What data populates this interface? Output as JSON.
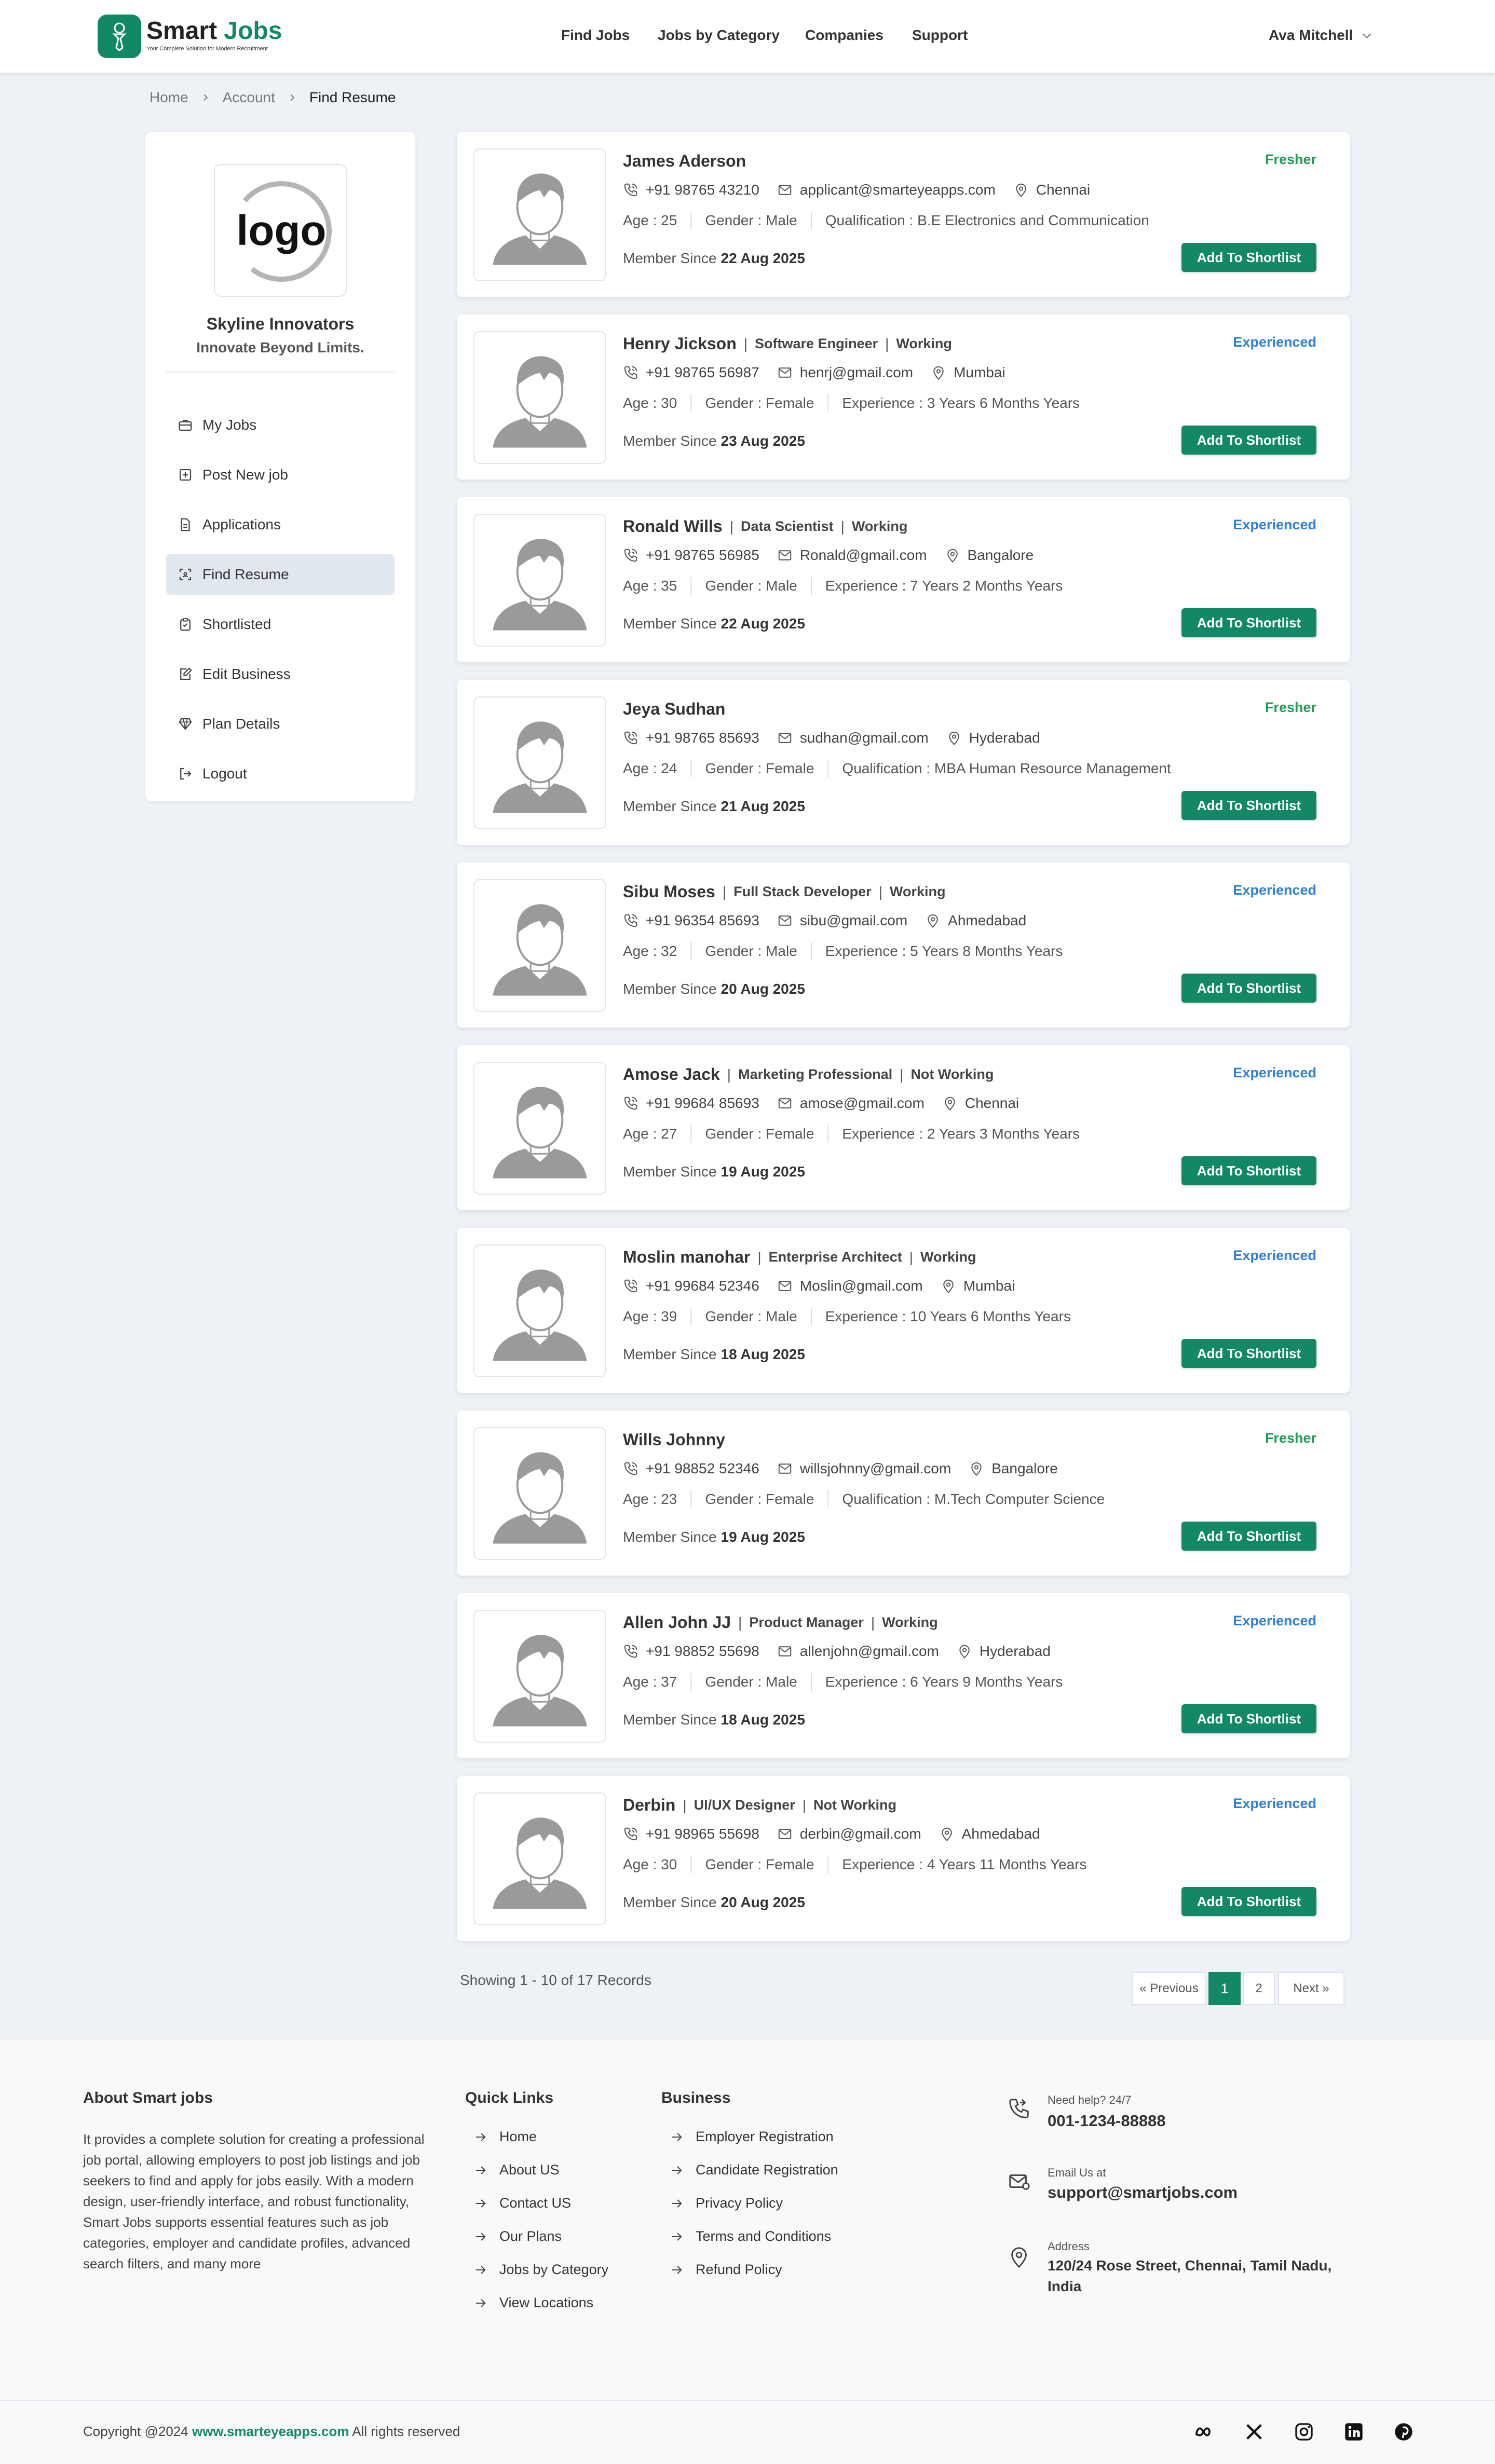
{
  "brand": {
    "name_a": "Smart",
    "name_b": "Jobs",
    "tagline": "Your Complete Solution for Modern Recruitment"
  },
  "nav": {
    "items": [
      "Find Jobs",
      "Jobs by Category",
      "Companies",
      "Support"
    ],
    "user": "Ava Mitchell"
  },
  "breadcrumb": [
    "Home",
    "Account",
    "Find Resume"
  ],
  "company": {
    "logo_text": "logo",
    "name": "Skyline Innovators",
    "tagline": "Innovate Beyond Limits."
  },
  "menu": [
    {
      "label": "My Jobs",
      "icon": "briefcase-icon"
    },
    {
      "label": "Post New job",
      "icon": "plus-square-icon"
    },
    {
      "label": "Applications",
      "icon": "document-icon"
    },
    {
      "label": "Find Resume",
      "icon": "scan-icon",
      "active": true
    },
    {
      "label": "Shortlisted",
      "icon": "clipboard-check-icon"
    },
    {
      "label": "Edit Business",
      "icon": "edit-icon"
    },
    {
      "label": "Plan Details",
      "icon": "diamond-icon"
    },
    {
      "label": "Logout",
      "icon": "logout-icon"
    }
  ],
  "labels": {
    "member_since": "Member Since",
    "shortlist_button": "Add To Shortlist"
  },
  "candidates": [
    {
      "name": "James Aderson",
      "role": "",
      "work_status": "",
      "type": "Fresher",
      "phone": "+91 98765 43210",
      "email": "applicant@smarteyeapps.com",
      "location": "Chennai",
      "age": "Age : 25",
      "gender": "Gender : Male",
      "detail": "Qualification : B.E Electronics and Communication",
      "date": "22 Aug 2025"
    },
    {
      "name": "Henry Jickson",
      "role": "Software Engineer",
      "work_status": "Working",
      "type": "Experienced",
      "phone": "+91 98765 56987",
      "email": "henrj@gmail.com",
      "location": "Mumbai",
      "age": "Age : 30",
      "gender": "Gender : Female",
      "detail": "Experience : 3 Years 6 Months Years",
      "date": "23 Aug 2025"
    },
    {
      "name": "Ronald Wills",
      "role": "Data Scientist",
      "work_status": "Working",
      "type": "Experienced",
      "phone": "+91 98765 56985",
      "email": "Ronald@gmail.com",
      "location": "Bangalore",
      "age": "Age : 35",
      "gender": "Gender : Male",
      "detail": "Experience : 7 Years 2 Months Years",
      "date": "22 Aug 2025"
    },
    {
      "name": "Jeya Sudhan",
      "role": "",
      "work_status": "",
      "type": "Fresher",
      "phone": "+91 98765 85693",
      "email": "sudhan@gmail.com",
      "location": "Hyderabad",
      "age": "Age : 24",
      "gender": "Gender : Female",
      "detail": "Qualification : MBA Human Resource Management",
      "date": "21 Aug 2025"
    },
    {
      "name": "Sibu Moses",
      "role": "Full Stack Developer",
      "work_status": "Working",
      "type": "Experienced",
      "phone": "+91 96354 85693",
      "email": "sibu@gmail.com",
      "location": "Ahmedabad",
      "age": "Age : 32",
      "gender": "Gender : Male",
      "detail": "Experience : 5 Years 8 Months Years",
      "date": "20 Aug 2025"
    },
    {
      "name": "Amose Jack",
      "role": "Marketing Professional",
      "work_status": "Not Working",
      "type": "Experienced",
      "phone": "+91 99684 85693",
      "email": "amose@gmail.com",
      "location": "Chennai",
      "age": "Age : 27",
      "gender": "Gender : Female",
      "detail": "Experience : 2 Years 3 Months Years",
      "date": "19 Aug 2025"
    },
    {
      "name": "Moslin manohar",
      "role": "Enterprise Architect",
      "work_status": "Working",
      "type": "Experienced",
      "phone": "+91 99684 52346",
      "email": "Moslin@gmail.com",
      "location": "Mumbai",
      "age": "Age : 39",
      "gender": "Gender : Male",
      "detail": "Experience : 10 Years 6 Months Years",
      "date": "18 Aug 2025"
    },
    {
      "name": "Wills Johnny",
      "role": "",
      "work_status": "",
      "type": "Fresher",
      "phone": "+91 98852 52346",
      "email": "willsjohnny@gmail.com",
      "location": "Bangalore",
      "age": "Age : 23",
      "gender": "Gender : Female",
      "detail": "Qualification : M.Tech Computer Science",
      "date": "19 Aug 2025"
    },
    {
      "name": "Allen John JJ",
      "role": "Product Manager",
      "work_status": "Working",
      "type": "Experienced",
      "phone": "+91 98852 55698",
      "email": "allenjohn@gmail.com",
      "location": "Hyderabad",
      "age": "Age : 37",
      "gender": "Gender : Male",
      "detail": "Experience : 6 Years 9 Months Years",
      "date": "18 Aug 2025"
    },
    {
      "name": "Derbin",
      "role": "UI/UX Designer",
      "work_status": "Not Working",
      "type": "Experienced",
      "phone": "+91 98965 55698",
      "email": "derbin@gmail.com",
      "location": "Ahmedabad",
      "age": "Age : 30",
      "gender": "Gender : Female",
      "detail": "Experience : 4 Years 11 Months Years",
      "date": "20 Aug 2025"
    }
  ],
  "pagination": {
    "summary": "Showing 1 - 10 of 17 Records",
    "prev": "« Previous",
    "pages": [
      "1",
      "2"
    ],
    "current": "1",
    "next": "Next »"
  },
  "footer": {
    "about_title": "About Smart jobs",
    "about_text": "It provides a complete solution for creating a professional job portal, allowing employers to post job listings and job seekers to find and apply for jobs easily. With a modern design, user-friendly interface, and robust functionality, Smart Jobs supports essential features such as job categories, employer and candidate profiles, advanced search filters, and many more",
    "quick_title": "Quick Links",
    "quick_links": [
      "Home",
      "About US",
      "Contact US",
      "Our Plans",
      "Jobs by Category",
      "View Locations"
    ],
    "business_title": "Business",
    "business_links": [
      "Employer Registration",
      "Candidate Registration",
      "Privacy Policy",
      "Terms and Conditions",
      "Refund Policy"
    ],
    "help_label": "Need help? 24/7",
    "phone": "001-1234-88888",
    "email_label": "Email Us at",
    "email": "support@smartjobs.com",
    "address_label": "Address",
    "address": "120/24 Rose Street, Chennai, Tamil Nadu, India",
    "copyright_a": "Copyright @2024",
    "copyright_link": "www.smarteyeapps.com",
    "copyright_b": "All rights reserved",
    "social": [
      "meta-icon",
      "x-icon",
      "instagram-icon",
      "linkedin-icon",
      "pinterest-icon"
    ]
  },
  "colors": {
    "accent": "#128866",
    "fresher": "#1f9d55",
    "experienced": "#2f7fd6",
    "background": "#eef1f6"
  }
}
